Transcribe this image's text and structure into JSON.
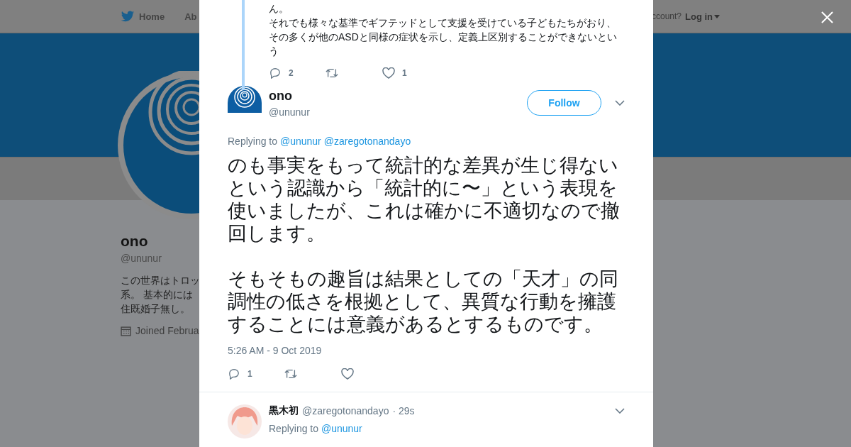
{
  "nav": {
    "items": [
      {
        "label": "Home"
      },
      {
        "label": "Ab"
      }
    ],
    "account_prompt": "ccount?",
    "login": "Log in"
  },
  "profile": {
    "name": "ono",
    "handle": "@ununur",
    "bio_lines": [
      "この世界はトロッ",
      "系。 基本的には",
      "住既婚子無し。"
    ],
    "joined": "Joined Februa"
  },
  "parent_tweet": {
    "paragraphs": [
      "ん。",
      "それでも様々な基準でギフテッドとして支援を受けている子どもたちがおり、その多くが他のASDと同様の症状を示し、定義上区別することができないという"
    ],
    "replies": "2",
    "likes": "1"
  },
  "tweet": {
    "name": "ono",
    "handle": "@ununur",
    "follow": "Follow",
    "replying_label": "Replying to",
    "replying_to": [
      "@ununur",
      "@zaregotonandayo"
    ],
    "paragraphs": [
      "のも事実をもって統計的な差異が生じ得ないという認識から「統計的に〜」という表現を使いましたが、これは確かに不適切なので撤回します。",
      "そもそもの趣旨は結果としての「天才」の同調性の低さを根拠として、異質な行動を擁護することには意義があるとするものです。"
    ],
    "time": "5:26 AM - 9 Oct 2019",
    "replies": "1"
  },
  "reply": {
    "name": "黒木初",
    "handle": "@zaregotonandayo",
    "age": "· 29s",
    "replying_label": "Replying to",
    "replying_to": [
      "@ununur"
    ]
  }
}
